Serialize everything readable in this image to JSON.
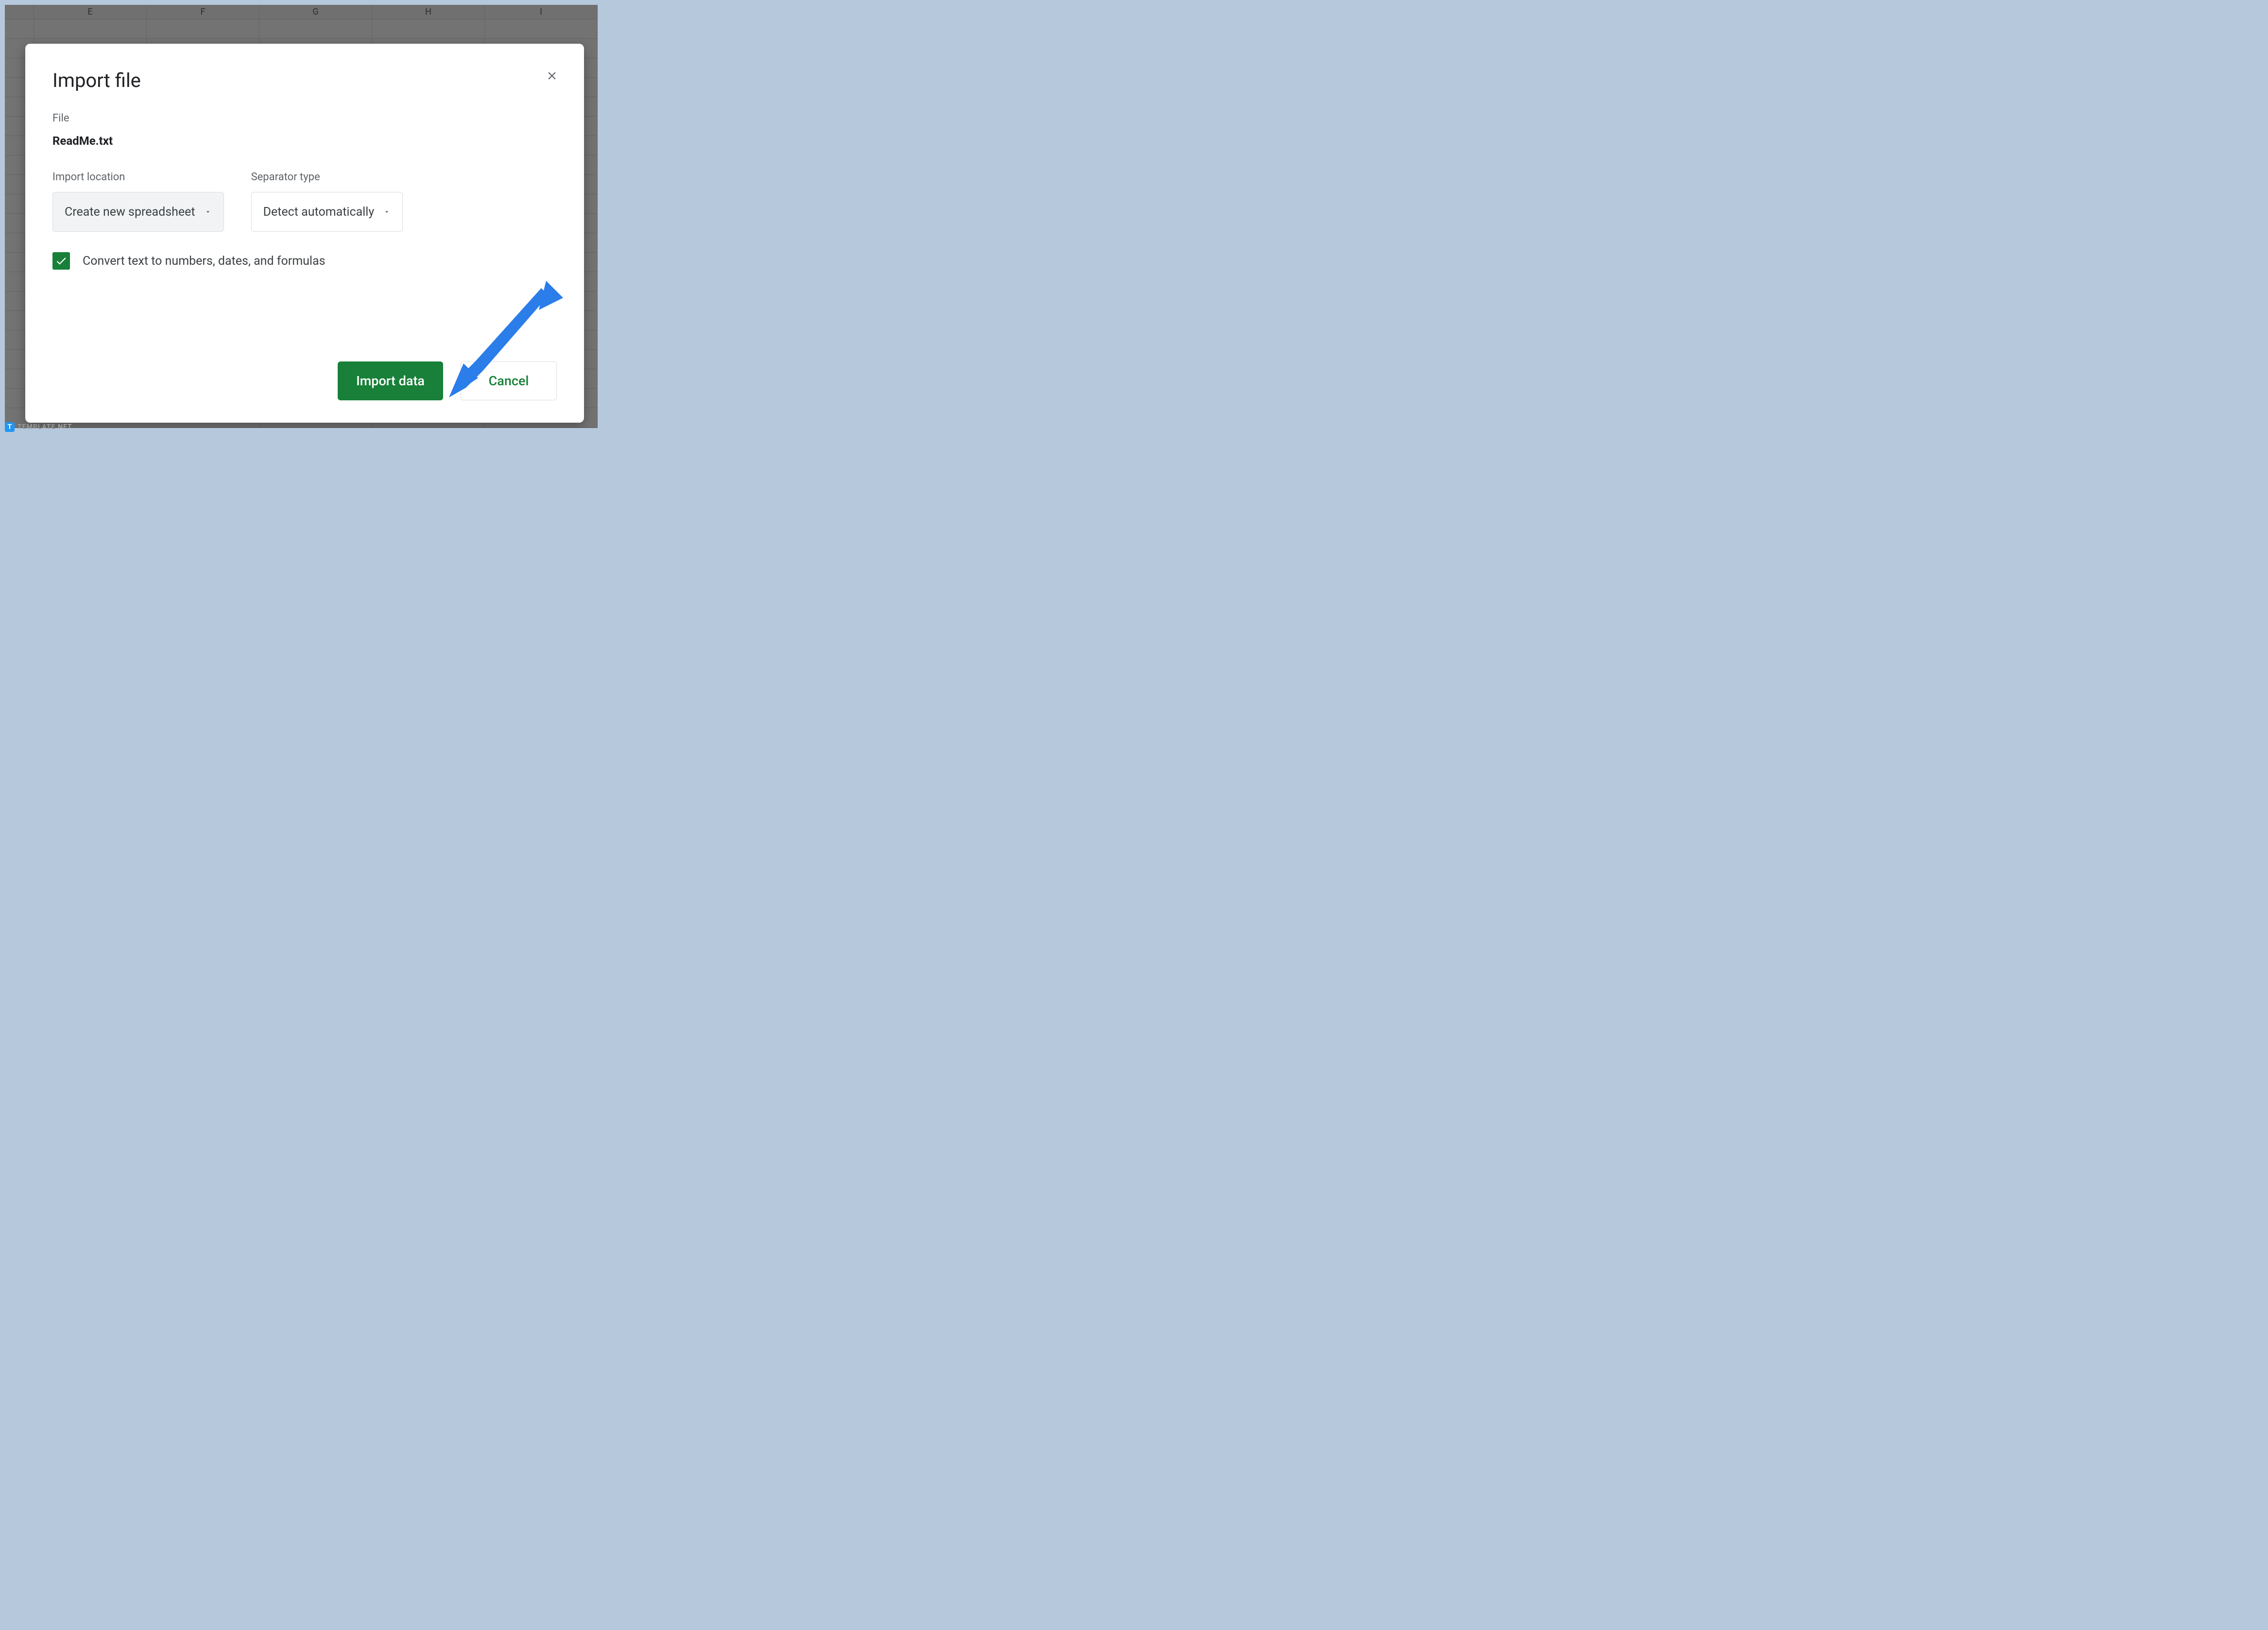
{
  "spreadsheet": {
    "columns": [
      "",
      "E",
      "F",
      "G",
      "H",
      "I"
    ]
  },
  "dialog": {
    "title": "Import file",
    "file_label": "File",
    "file_name": "ReadMe.txt",
    "import_location": {
      "label": "Import location",
      "value": "Create new spreadsheet"
    },
    "separator_type": {
      "label": "Separator type",
      "value": "Detect automatically"
    },
    "checkbox": {
      "checked": true,
      "label": "Convert text to numbers, dates, and formulas"
    },
    "actions": {
      "primary": "Import data",
      "secondary": "Cancel"
    }
  },
  "watermark": {
    "badge": "T",
    "text1": "TEMPLATE",
    "text2": ".NET"
  },
  "colors": {
    "brand_green": "#188038",
    "annotation_blue": "#2b7de9"
  }
}
